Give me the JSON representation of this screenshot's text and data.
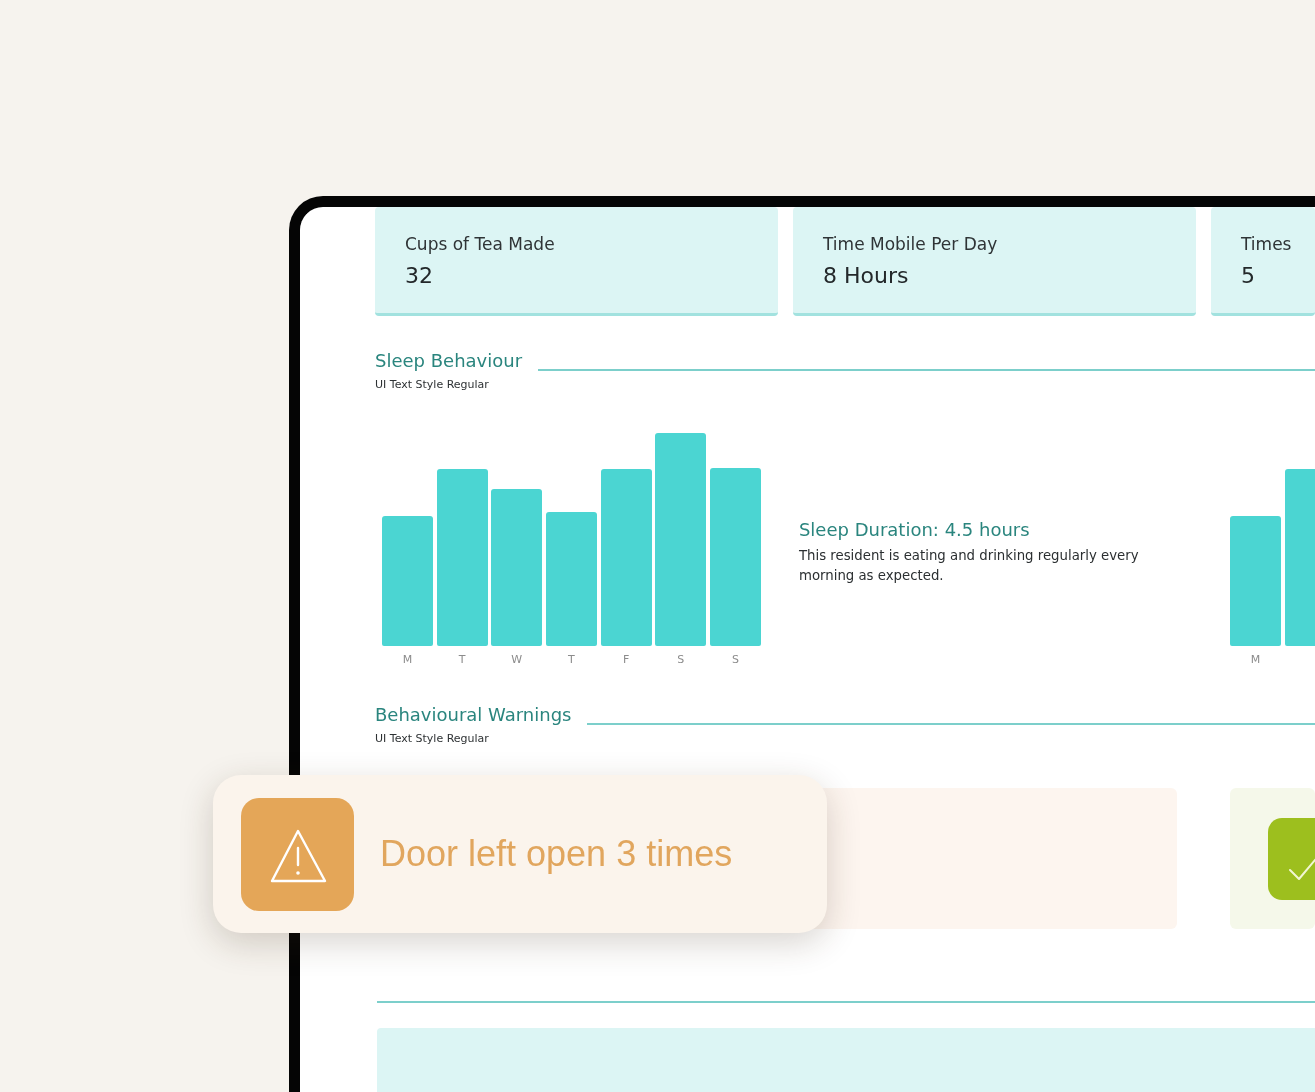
{
  "stat_cards": [
    {
      "label": "Cups of Tea Made",
      "value": "32"
    },
    {
      "label": "Time Mobile Per Day",
      "value": "8 Hours"
    },
    {
      "label": "Times",
      "value": "5"
    }
  ],
  "sleep_section": {
    "title": "Sleep Behaviour",
    "subtitle": "UI Text Style Regular",
    "chart": {
      "x_labels": [
        "M",
        "T",
        "W",
        "T",
        "F",
        "S",
        "S"
      ]
    },
    "summary": {
      "title": "Sleep Duration: 4.5 hours",
      "text": "This resident is eating and drinking regularly every morning as expected."
    },
    "second_chart": {
      "x_labels": [
        "M"
      ]
    }
  },
  "warnings_section": {
    "title": "Behavioural Warnings",
    "subtitle": "UI Text Style Regular",
    "cards": [
      {
        "kind": "warning"
      },
      {
        "kind": "ok"
      }
    ]
  },
  "alert_popup": {
    "kind": "warning",
    "text": "Door left open 3 times"
  }
}
